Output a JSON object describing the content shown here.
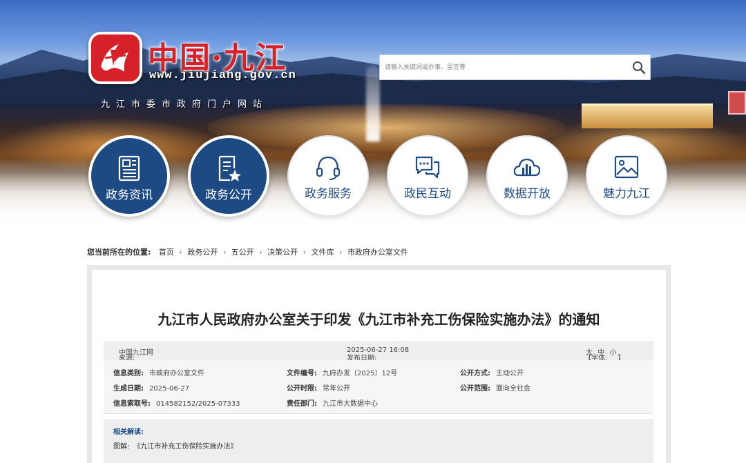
{
  "header": {
    "site_name": "中国·九江",
    "site_url": "www.jiujiang.gov.cn",
    "site_subtitle": "九江市委市政府门户网站",
    "logo_icon": "jiujiang-logo-icon"
  },
  "search": {
    "placeholder": "请输入关键词或办事、留言等",
    "icon": "search-icon"
  },
  "nav": [
    {
      "label": "政务资讯",
      "icon": "newspaper-icon",
      "style": "dark"
    },
    {
      "label": "政务公开",
      "icon": "document-star-icon",
      "style": "dark"
    },
    {
      "label": "政务服务",
      "icon": "headset-icon",
      "style": "light"
    },
    {
      "label": "政民互动",
      "icon": "chat-bubbles-icon",
      "style": "light"
    },
    {
      "label": "数据开放",
      "icon": "cloud-chart-icon",
      "style": "light"
    },
    {
      "label": "魅力九江",
      "icon": "picture-icon",
      "style": "light"
    }
  ],
  "breadcrumb": {
    "lead": "您当前所在的位置:",
    "items": [
      "首页",
      "政务公开",
      "五公开",
      "决策公开",
      "文件库",
      "市政府办公室文件"
    ],
    "separator": "›"
  },
  "article": {
    "title": "九江市人民政府办公室关于印发《九江市补充工伤保险实施办法》的通知",
    "source_label": "来源:",
    "source": "中国九江网",
    "date_label": "发布日期:",
    "date": "2025-06-27 16:08",
    "font_label": "【字体:",
    "font_large": "大",
    "font_medium": "中",
    "font_small": "小",
    "font_end": "】"
  },
  "info": {
    "category_label": "信息类别:",
    "category": "市政府办公室文件",
    "doc_no_label": "文件编号:",
    "doc_no": "九府办发〔2025〕12号",
    "open_mode_label": "公开方式:",
    "open_mode": "主动公开",
    "created_label": "生成日期:",
    "created": "2025-06-27",
    "period_label": "公开时限:",
    "period": "常年公开",
    "scope_label": "公开范围:",
    "scope": "面向全社会",
    "index_label": "信息索取号:",
    "index": "014582152/2025-07333",
    "dept_label": "责任部门:",
    "dept": "九江市大数据中心"
  },
  "related": {
    "title": "相关解读:",
    "item_prefix": "图解:",
    "item_link": "《九江市补充工伤保险实施办法》"
  },
  "colors": {
    "brand_red": "#d6212a",
    "nav_blue": "#1e4a83"
  }
}
